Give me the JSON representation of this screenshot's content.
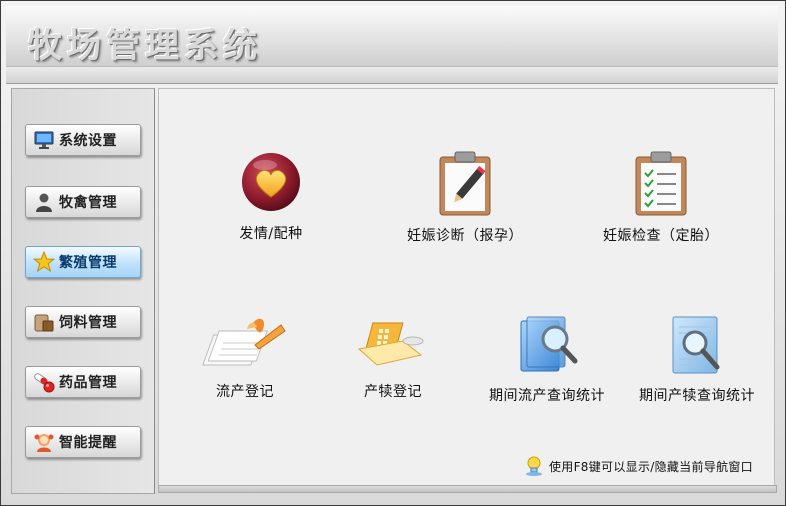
{
  "app": {
    "title": "牧场管理系统"
  },
  "sidebar": {
    "items": [
      {
        "label": "系统设置",
        "icon": "monitor-icon",
        "active": false
      },
      {
        "label": "牧禽管理",
        "icon": "user-icon",
        "active": false
      },
      {
        "label": "繁殖管理",
        "icon": "star-icon",
        "active": true
      },
      {
        "label": "饲料管理",
        "icon": "feed-bag-icon",
        "active": false
      },
      {
        "label": "药品管理",
        "icon": "pills-icon",
        "active": false
      },
      {
        "label": "智能提醒",
        "icon": "reminder-icon",
        "active": false
      }
    ]
  },
  "main": {
    "tiles": [
      {
        "label": "发情/配种",
        "icon": "heart-icon"
      },
      {
        "label": "妊娠诊断（报孕）",
        "icon": "clipboard-pencil-icon"
      },
      {
        "label": "妊娠检查（定胎）",
        "icon": "clipboard-checklist-icon"
      },
      {
        "label": "流产登记",
        "icon": "papers-pen-icon"
      },
      {
        "label": "产犊登记",
        "icon": "document-folder-icon"
      },
      {
        "label": "期间流产查询统计",
        "icon": "folder-search-icon"
      },
      {
        "label": "期间产犊查询统计",
        "icon": "document-search-icon"
      }
    ],
    "hint": {
      "text": "使用F8键可以显示/隐藏当前导航窗口",
      "icon": "lightbulb-icon"
    }
  },
  "colors": {
    "active_nav": "#bfe2fb",
    "heart": "#8b1a2b",
    "clipboard": "#c2875a"
  }
}
